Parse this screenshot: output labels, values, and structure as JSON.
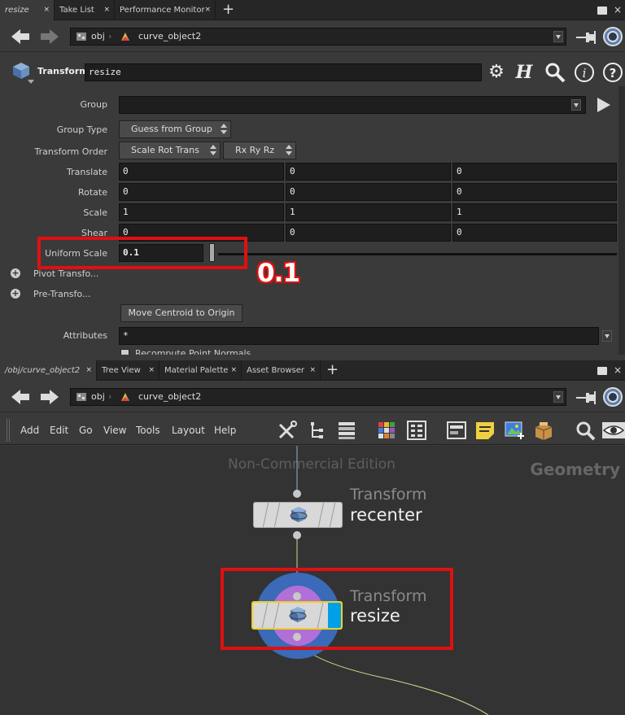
{
  "top_tabs": [
    {
      "label": "resize",
      "active": true
    },
    {
      "label": "Take List",
      "active": false
    },
    {
      "label": "Performance Monitor",
      "active": false
    }
  ],
  "top_path": {
    "root": "obj",
    "node": "curve_object2"
  },
  "param_header": {
    "node_type": "Transform",
    "node_name": "resize"
  },
  "params": {
    "group_label": "Group",
    "group_value": "",
    "group_type_label": "Group Type",
    "group_type_value": "Guess from Group",
    "xform_order_label": "Transform Order",
    "xform_order_value": "Scale Rot Trans",
    "rot_order_value": "Rx Ry Rz",
    "translate_label": "Translate",
    "translate": [
      "0",
      "0",
      "0"
    ],
    "rotate_label": "Rotate",
    "rotate": [
      "0",
      "0",
      "0"
    ],
    "scale_label": "Scale",
    "scale": [
      "1",
      "1",
      "1"
    ],
    "shear_label": "Shear",
    "shear": [
      "0",
      "0",
      "0"
    ],
    "uniform_scale_label": "Uniform Scale",
    "uniform_scale_value": "0.1",
    "pivot_folder": "Pivot Transfo...",
    "pretransform_folder": "Pre-Transfo...",
    "move_centroid_label": "Move Centroid to Origin",
    "attributes_label": "Attributes",
    "attributes_value": "*",
    "recompute_label": "Recompute Point Normals"
  },
  "annotation": {
    "text": "0.1",
    "color": "#e01010"
  },
  "bottom_tabs": [
    {
      "label": "/obj/curve_object2",
      "active": true
    },
    {
      "label": "Tree View",
      "active": false
    },
    {
      "label": "Material Palette",
      "active": false
    },
    {
      "label": "Asset Browser",
      "active": false
    }
  ],
  "bottom_path": {
    "root": "obj",
    "node": "curve_object2"
  },
  "menu": [
    "Add",
    "Edit",
    "Go",
    "View",
    "Tools",
    "Layout",
    "Help"
  ],
  "network": {
    "watermark": "Non-Commercial Edition",
    "context": "Geometry",
    "nodes": [
      {
        "type": "Transform",
        "name": "recenter"
      },
      {
        "type": "Transform",
        "name": "resize",
        "selected": true
      }
    ]
  },
  "colors": {
    "highlight_red": "#e01010",
    "display_flag": "#00a0e8",
    "selection_ring": "#3a6ab8",
    "template_ring": "#b070d8"
  }
}
